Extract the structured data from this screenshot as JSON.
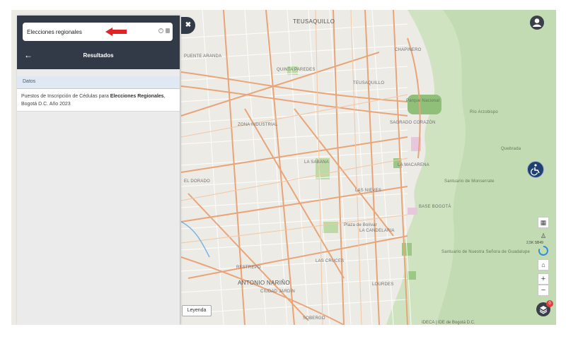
{
  "search": {
    "value": "Elecciones regionales"
  },
  "panel": {
    "results_title": "Resultados",
    "section_label": "Datos",
    "result_prefix": "Puestos de Inscripción de Cédulas para ",
    "result_highlight_1": "Elecciones",
    "result_highlight_2": "Regionales",
    "result_suffix": ", Bogotá D.C. Año 2023"
  },
  "map": {
    "places": [
      "TEUSAQUILLO",
      "CHAPINERO",
      "QUINTA PAREDES",
      "PUENTE ARANDA",
      "TEUSAQUILLO",
      "SAGRADO CORAZÓN",
      "ZONA INDUSTRIAL",
      "LA SABANA",
      "LA MACARENA",
      "LAS NIEVES",
      "LA CANDELARIA",
      "LAS CRUCES",
      "ANTONIO NARIÑO",
      "RESTREPO",
      "CIUDAD JARDÍN",
      "SOBERGO",
      "LOURDES",
      "EL DORADO",
      "Parque Nacional",
      "Plaza de Bolívar",
      "Santuario de Monserrate",
      "Santuario de Nuestra Señora de Guadalupe",
      "Río Arzobispo",
      "Quebrada",
      "BASE BOGOTÁ"
    ]
  },
  "controls": {
    "legend_label": "Leyenda",
    "layers_badge": "0",
    "zoom_in": "+",
    "zoom_out": "−",
    "zoom_level_label": "2,5K SB49"
  },
  "attribution": "IDECA | IDE de Bogotá D.C.",
  "colors": {
    "panel_header": "#323a47",
    "accent_arrow": "#e02424",
    "park_green": "#a9cf92"
  }
}
